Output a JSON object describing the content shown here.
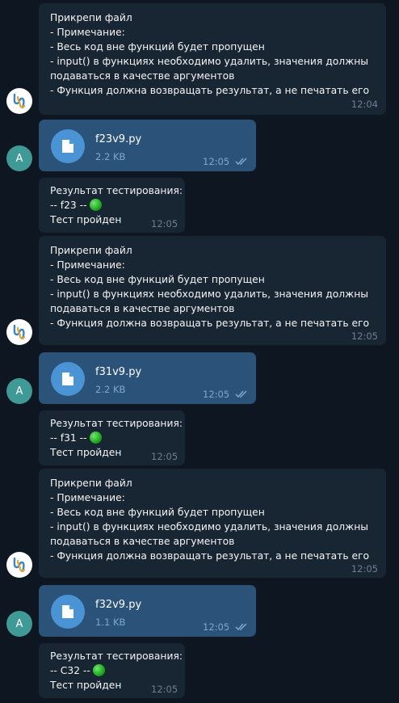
{
  "avatars": {
    "user_letter": "A",
    "bot_icon": "bot-icon"
  },
  "groups": [
    {
      "prompt": {
        "text": "Прикрепи файл\n- Примечание:\n- Весь код вне функций будет пропущен\n- input() в функциях необходимо удалить, значения должны\nподаваться в качестве аргументов\n- Функция должна возвращать результат, а не печатать его",
        "time": "12:04"
      },
      "file": {
        "name": "f23v9.py",
        "size": "2.2 KB",
        "time": "12:05"
      },
      "result": {
        "title": "Результат тестирования:",
        "line": "-- f23 --",
        "status": "Тест пройден",
        "time": "12:05"
      }
    },
    {
      "prompt": {
        "text": "Прикрепи файл\n- Примечание:\n- Весь код вне функций будет пропущен\n- input() в функциях необходимо удалить, значения должны\nподаваться в качестве аргументов\n- Функция должна возвращать результат, а не печатать его",
        "time": "12:05"
      },
      "file": {
        "name": "f31v9.py",
        "size": "2.2 KB",
        "time": "12:05"
      },
      "result": {
        "title": "Результат тестирования:",
        "line": "-- f31 --",
        "status": "Тест пройден",
        "time": "12:05"
      }
    },
    {
      "prompt": {
        "text": "Прикрепи файл\n- Примечание:\n- Весь код вне функций будет пропущен\n- input() в функциях необходимо удалить, значения должны\nподаваться в качестве аргументов\n- Функция должна возвращать результат, а не печатать его",
        "time": "12:05"
      },
      "file": {
        "name": "f32v9.py",
        "size": "1.1 KB",
        "time": "12:05"
      },
      "result": {
        "title": "Результат тестирования:",
        "line": "-- C32 --",
        "status": "Тест пройден",
        "time": "12:05"
      }
    }
  ]
}
